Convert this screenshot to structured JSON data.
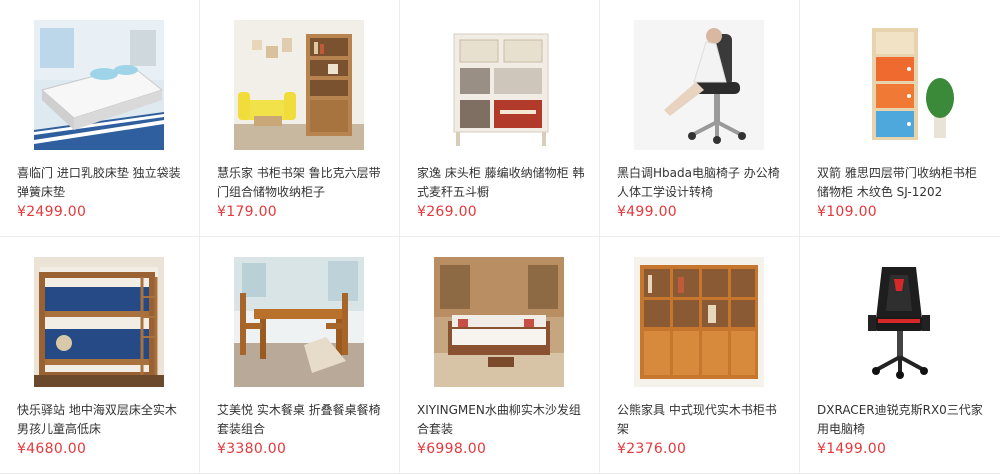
{
  "accent_price_color": "#e4393c",
  "products": [
    {
      "title": "喜临门 进口乳胶床垫 独立袋装弹簧床垫",
      "price": "¥2499.00",
      "image": "mattress-image"
    },
    {
      "title": "慧乐家 书柜书架 鲁比克六层带门组合储物收纳柜子",
      "price": "¥179.00",
      "image": "bookshelf-image"
    },
    {
      "title": "家逸 床头柜 藤编收纳储物柜 韩式麦秆五斗橱",
      "price": "¥269.00",
      "image": "storage-cabinet-image"
    },
    {
      "title": "黑白调Hbada电脑椅子 办公椅 人体工学设计转椅",
      "price": "¥499.00",
      "image": "office-chair-image"
    },
    {
      "title": "双箭 雅思四层带门收纳柜书柜储物柜 木纹色 SJ-1202",
      "price": "¥109.00",
      "image": "color-cabinet-image"
    },
    {
      "title": "快乐驿站 地中海双层床全实木男孩儿童高低床",
      "price": "¥4680.00",
      "image": "bunk-bed-image"
    },
    {
      "title": "艾美悦 实木餐桌 折叠餐桌餐椅套装组合",
      "price": "¥3380.00",
      "image": "dining-set-image"
    },
    {
      "title": "XIYINGMEN水曲柳实木沙发组合套装",
      "price": "¥6998.00",
      "image": "wood-sofa-image"
    },
    {
      "title": "公熊家具 中式现代实木书柜书架",
      "price": "¥2376.00",
      "image": "wood-bookcase-image"
    },
    {
      "title": "DXRACER迪锐克斯RX0三代家用电脑椅",
      "price": "¥1499.00",
      "image": "gaming-chair-image"
    }
  ]
}
